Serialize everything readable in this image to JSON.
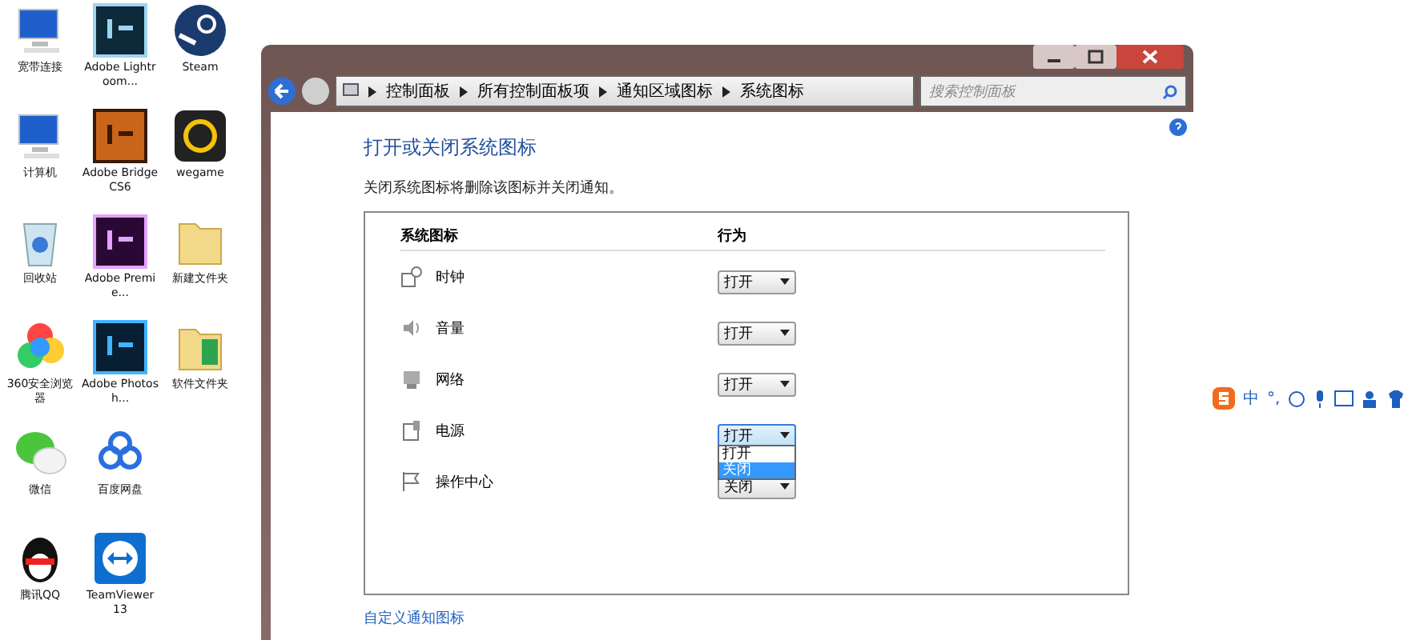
{
  "desktop_icons": [
    {
      "label": "宽带连接",
      "kind": "network"
    },
    {
      "label": "Adobe Lightroom...",
      "kind": "lr"
    },
    {
      "label": "Steam",
      "kind": "steam"
    },
    {
      "label": "计算机",
      "kind": "computer"
    },
    {
      "label": "Adobe Bridge CS6",
      "kind": "br"
    },
    {
      "label": "wegame",
      "kind": "wegame"
    },
    {
      "label": "回收站",
      "kind": "bin"
    },
    {
      "label": "Adobe Premie...",
      "kind": "pr"
    },
    {
      "label": "新建文件夹",
      "kind": "folder"
    },
    {
      "label": "360安全浏览器",
      "kind": "pinwheel"
    },
    {
      "label": "Adobe Photosh...",
      "kind": "ps"
    },
    {
      "label": "软件文件夹",
      "kind": "greenfolder"
    },
    {
      "label": "微信",
      "kind": "wechat"
    },
    {
      "label": "百度网盘",
      "kind": "cloud"
    },
    {
      "kind": "none"
    },
    {
      "label": "腾讯QQ",
      "kind": "qq"
    },
    {
      "label": "TeamViewer 13",
      "kind": "teamviewer"
    }
  ],
  "window": {
    "breadcrumb": [
      "控制面板",
      "所有控制面板项",
      "通知区域图标",
      "系统图标"
    ],
    "search": {
      "placeholder": "搜索控制面板"
    },
    "heading": "打开或关闭系统图标",
    "description": "关闭系统图标将删除该图标并关闭通知。",
    "table": {
      "columns": [
        "系统图标",
        "行为"
      ],
      "rows": [
        {
          "kind": "clock",
          "name": "时钟",
          "value": "打开",
          "open": false
        },
        {
          "kind": "speaker",
          "name": "音量",
          "value": "打开",
          "open": false
        },
        {
          "kind": "network",
          "name": "网络",
          "value": "打开",
          "open": false
        },
        {
          "kind": "power",
          "name": "电源",
          "value": "打开",
          "open": true,
          "options": [
            {
              "label": "打开",
              "highlighted": false
            },
            {
              "label": "关闭",
              "highlighted": true
            }
          ]
        },
        {
          "kind": "flag",
          "name": "操作中心",
          "value": "关闭",
          "open": false
        }
      ]
    },
    "links": [
      "自定义通知图标"
    ]
  },
  "ime_bar": {
    "items": [
      "中",
      "°,"
    ]
  }
}
